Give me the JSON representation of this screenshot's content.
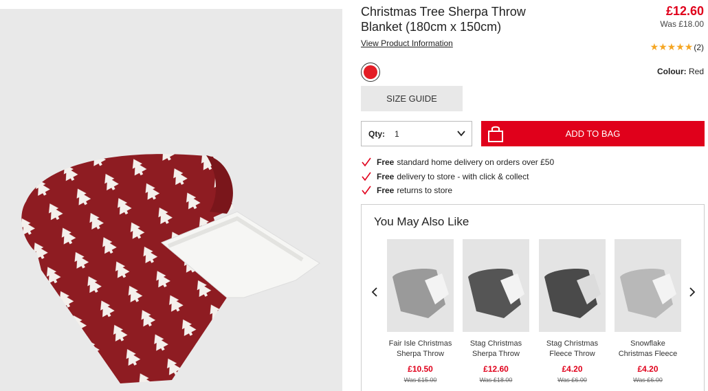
{
  "product": {
    "title": "Christmas Tree Sherpa Throw Blanket (180cm x 150cm)",
    "price": "£12.60",
    "was_price": "Was £18.00",
    "view_info_label": "View Product Information",
    "rating_stars": "★★★★★",
    "rating_count": "(2)",
    "colour_label": "Colour:",
    "colour_value": "Red",
    "swatch_color": "#e41e26"
  },
  "actions": {
    "size_guide_label": "SIZE GUIDE",
    "qty_label": "Qty:",
    "qty_value": "1",
    "add_to_bag_label": "ADD TO BAG"
  },
  "perks": [
    {
      "bold": "Free",
      "text": "standard home delivery on orders over £50"
    },
    {
      "bold": "Free",
      "text": "delivery to store - with click & collect"
    },
    {
      "bold": "Free",
      "text": "returns to store"
    }
  ],
  "recommendations": {
    "heading": "You May Also Like",
    "items": [
      {
        "name": "Fair Isle Christmas Sherpa Throw",
        "price": "£10.50",
        "was": "Was £15.00",
        "thumb_color": "#9a9a9a"
      },
      {
        "name": "Stag Christmas Sherpa Throw",
        "price": "£12.60",
        "was": "Was £18.00",
        "thumb_color": "#555555"
      },
      {
        "name": "Stag Christmas Fleece Throw",
        "price": "£4.20",
        "was": "Was £6.00",
        "thumb_color": "#4a4a4a"
      },
      {
        "name": "Snowflake Christmas Fleece",
        "price": "£4.20",
        "was": "Was £6.00",
        "thumb_color": "#b8b8b8"
      }
    ]
  },
  "colors": {
    "accent": "#e0001b",
    "star": "#f5a623",
    "blanket_red": "#8e1c22"
  }
}
